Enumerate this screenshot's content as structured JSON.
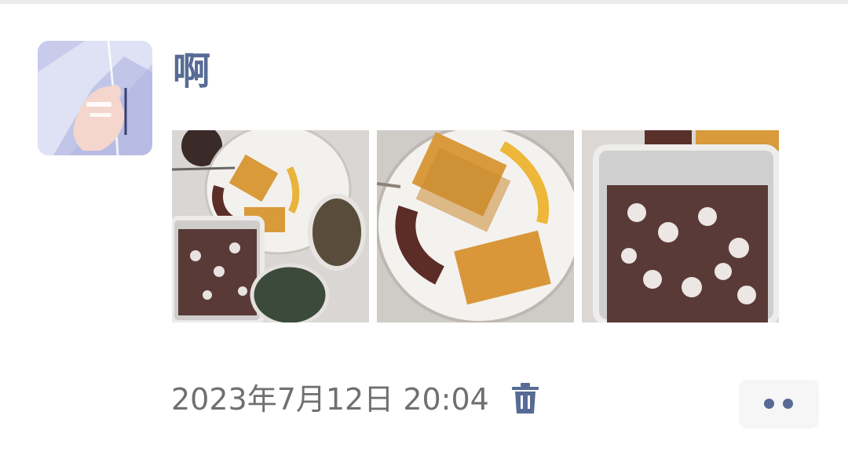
{
  "post": {
    "author_name": "啊",
    "avatar_icon": "hand-iv-drip-illustration",
    "photos": [
      {
        "alt": "food-photo",
        "icon": "food-plate-icon"
      },
      {
        "alt": "food-photo",
        "icon": "food-plate-icon"
      },
      {
        "alt": "food-photo",
        "icon": "food-plate-icon"
      }
    ],
    "timestamp": "2023年7月12日 20:04",
    "delete_icon": "trash-icon",
    "more_icon": "more-dots-icon"
  },
  "colors": {
    "accent": "#576b95",
    "timestamp": "#707070",
    "more_bg": "#f6f6f6"
  }
}
